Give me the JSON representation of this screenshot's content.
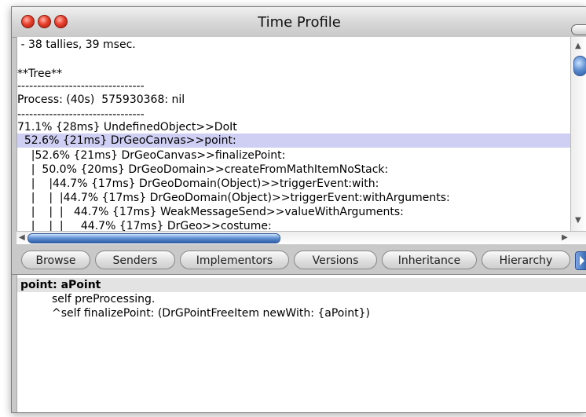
{
  "window": {
    "title": "Time Profile",
    "traffic_lights": [
      "close-button",
      "minimize-button",
      "zoom-button"
    ]
  },
  "profile_tree": {
    "lines": [
      " - 38 tallies, 39 msec.",
      "",
      "**Tree**",
      "--------------------------------",
      "Process: (40s)  575930368: nil",
      "--------------------------------",
      "71.1% {28ms} UndefinedObject>>DoIt",
      "  52.6% {21ms} DrGeoCanvas>>point:",
      "    |52.6% {21ms} DrGeoCanvas>>finalizePoint:",
      "    |  50.0% {20ms} DrGeoDomain>>createFromMathItemNoStack:",
      "    |    |44.7% {17ms} DrGeoDomain(Object)>>triggerEvent:with:",
      "    |    |  |44.7% {17ms} DrGeoDomain(Object)>>triggerEvent:withArguments:",
      "    |    |  |   44.7% {17ms} WeakMessageSend>>valueWithArguments:",
      "    |    |  |     44.7% {17ms} DrGeo>>costume:"
    ],
    "selected_index": 7
  },
  "toolbar": {
    "buttons": [
      "Browse",
      "Senders",
      "Implementors",
      "Versions",
      "Inheritance",
      "Hierarchy"
    ]
  },
  "code": {
    "selector_line": "point: aPoint",
    "body": [
      "self preProcessing.",
      "^self finalizePoint: (DrGPointFreeItem newWith: {aPoint})"
    ]
  }
}
